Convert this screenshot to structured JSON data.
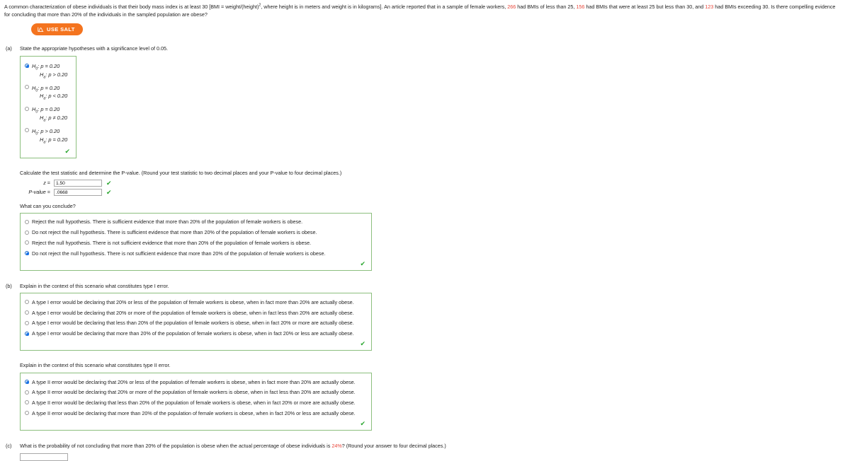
{
  "intro": {
    "part1": "A common characterization of obese individuals is that their body mass index is at least 30 [BMI = weight/(height)",
    "exponent": "2",
    "part2": ", where height is in meters and weight is in kilograms]. An article reported that in a sample of female workers, ",
    "n1": "266",
    "part3": " had BMIs of less than 25, ",
    "n2": "156",
    "part4": " had BMIs that were at least 25 but less than 30, and ",
    "n3": "123",
    "part5": " had BMIs exceeding 30. Is there compelling evidence for concluding that more than 20% of the individuals in the sampled population are obese?"
  },
  "salt": {
    "label": "USE SALT",
    "icon": "normal-curve-icon",
    "color": "#f4741f"
  },
  "parts": {
    "a": {
      "label": "(a)",
      "text": "State the appropriate hypotheses with a significance level of 0.05.",
      "options": [
        {
          "null": "H0: p = 0.20",
          "alt": "Ha: p > 0.20",
          "null_sym": "H",
          "null_sub": "0",
          "null_rest": ": p = 0.20",
          "alt_sym": "H",
          "alt_sub": "a",
          "alt_rest": ": p > 0.20",
          "selected": true
        },
        {
          "null_sym": "H",
          "null_sub": "0",
          "null_rest": ": p = 0.20",
          "alt_sym": "H",
          "alt_sub": "a",
          "alt_rest": ": p < 0.20",
          "selected": false
        },
        {
          "null_sym": "H",
          "null_sub": "0",
          "null_rest": ": p = 0.20",
          "alt_sym": "H",
          "alt_sub": "a",
          "alt_rest": ": p ≠ 0.20",
          "selected": false
        },
        {
          "null_sym": "H",
          "null_sub": "0",
          "null_rest": ": p > 0.20",
          "alt_sym": "H",
          "alt_sub": "a",
          "alt_rest": ": p = 0.20",
          "selected": false
        }
      ],
      "check": "✔",
      "calc_text": "Calculate the test statistic and determine the P-value. (Round your test statistic to two decimal places and your P-value to four decimal places.)",
      "z_label": "z",
      "z_eq": "=",
      "z_value": "1.50",
      "p_label": "P-value",
      "p_eq": "=",
      "p_value": ".0668",
      "conclude_q": "What can you conclude?",
      "conclusions": [
        {
          "text": "Reject the null hypothesis. There is sufficient evidence that more than 20% of the population of female workers is obese.",
          "selected": false
        },
        {
          "text": "Do not reject the null hypothesis. There is sufficient evidence that more than 20% of the population of female workers is obese.",
          "selected": false
        },
        {
          "text": "Reject the null hypothesis. There is not sufficient evidence that more than 20% of the population of female workers is obese.",
          "selected": false
        },
        {
          "text": "Do not reject the null hypothesis. There is not sufficient evidence that more than 20% of the population of female workers is obese.",
          "selected": true
        }
      ]
    },
    "b": {
      "label": "(b)",
      "type1_text": "Explain in the context of this scenario what constitutes type I error.",
      "type1_options": [
        {
          "text": "A type I error would be declaring that 20% or less of the population of female workers is obese, when in fact more than 20% are actually obese.",
          "selected": false
        },
        {
          "text": "A type I error would be declaring that 20% or more of the population of female workers is obese, when in fact less than 20% are actually obese.",
          "selected": false
        },
        {
          "text": "A type I error would be declaring that less than 20% of the population of female workers is obese, when in fact 20% or more are actually obese.",
          "selected": false
        },
        {
          "text": "A type I error would be declaring that more than 20% of the population of female workers is obese, when in fact 20% or less are actually obese.",
          "selected": true
        }
      ],
      "type2_text": "Explain in the context of this scenario what constitutes type II error.",
      "type2_options": [
        {
          "text": "A type II error would be declaring that 20% or less of the population of female workers is obese, when in fact more than 20% are actually obese.",
          "selected": true
        },
        {
          "text": "A type II error would be declaring that 20% or more of the population of female workers is obese, when in fact less than 20% are actually obese.",
          "selected": false
        },
        {
          "text": "A type II error would be declaring that less than 20% of the population of female workers is obese, when in fact 20% or more are actually obese.",
          "selected": false
        },
        {
          "text": "A type II error would be declaring that more than 20% of the population of female workers is obese, when in fact 20% or less are actually obese.",
          "selected": false
        }
      ]
    },
    "c": {
      "label": "(c)",
      "text_pre": "What is the probability of not concluding that more than 20% of the population is obese when the actual percentage of obese individuals is ",
      "pct": "24%",
      "text_post": "? (Round your answer to four decimal places.)",
      "value": ""
    }
  }
}
